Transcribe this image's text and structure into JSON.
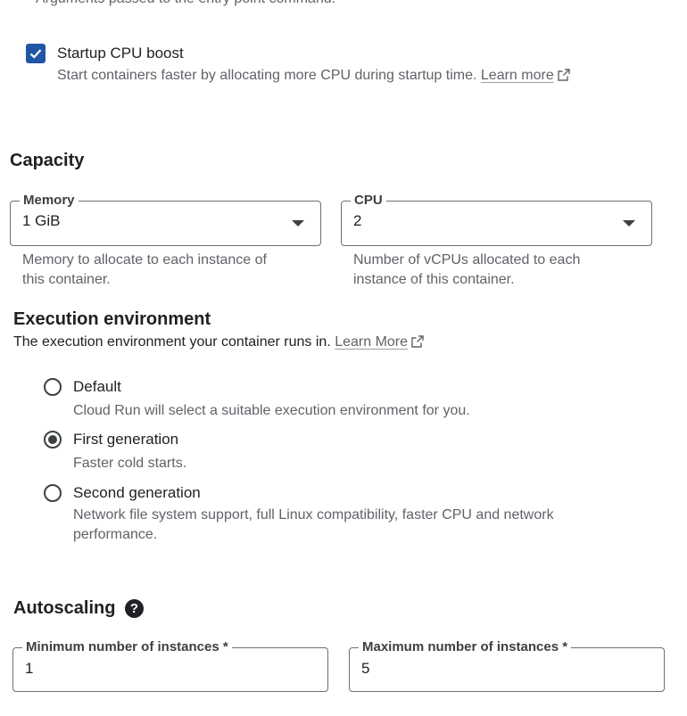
{
  "args": {
    "text": "Arguments passed to the entry point command."
  },
  "startup_boost": {
    "checked": true,
    "label": "Startup CPU boost",
    "description": "Start containers faster by allocating more CPU during startup time.",
    "link": "Learn more"
  },
  "capacity": {
    "title": "Capacity",
    "memory": {
      "label": "Memory",
      "value": "1 GiB",
      "hint_line1": "Memory to allocate to each instance of",
      "hint_line2": "this container."
    },
    "cpu": {
      "label": "CPU",
      "value": "2",
      "hint_line1": "Number of vCPUs allocated to each",
      "hint_line2": "instance of this container."
    }
  },
  "execution": {
    "title": "Execution environment",
    "description": "The execution environment your container runs in.",
    "link": "Learn More",
    "options": [
      {
        "label": "Default",
        "description": "Cloud Run will select a suitable execution environment for you.",
        "selected": false
      },
      {
        "label": "First generation",
        "description": "Faster cold starts.",
        "selected": true
      },
      {
        "label": "Second generation",
        "description_line1": "Network file system support, full Linux compatibility, faster CPU and network",
        "description_line2": "performance.",
        "selected": false
      }
    ]
  },
  "autoscaling": {
    "title": "Autoscaling",
    "min": {
      "label": "Minimum number of instances *",
      "value": "1"
    },
    "max": {
      "label": "Maximum number of instances *",
      "value": "5"
    }
  }
}
